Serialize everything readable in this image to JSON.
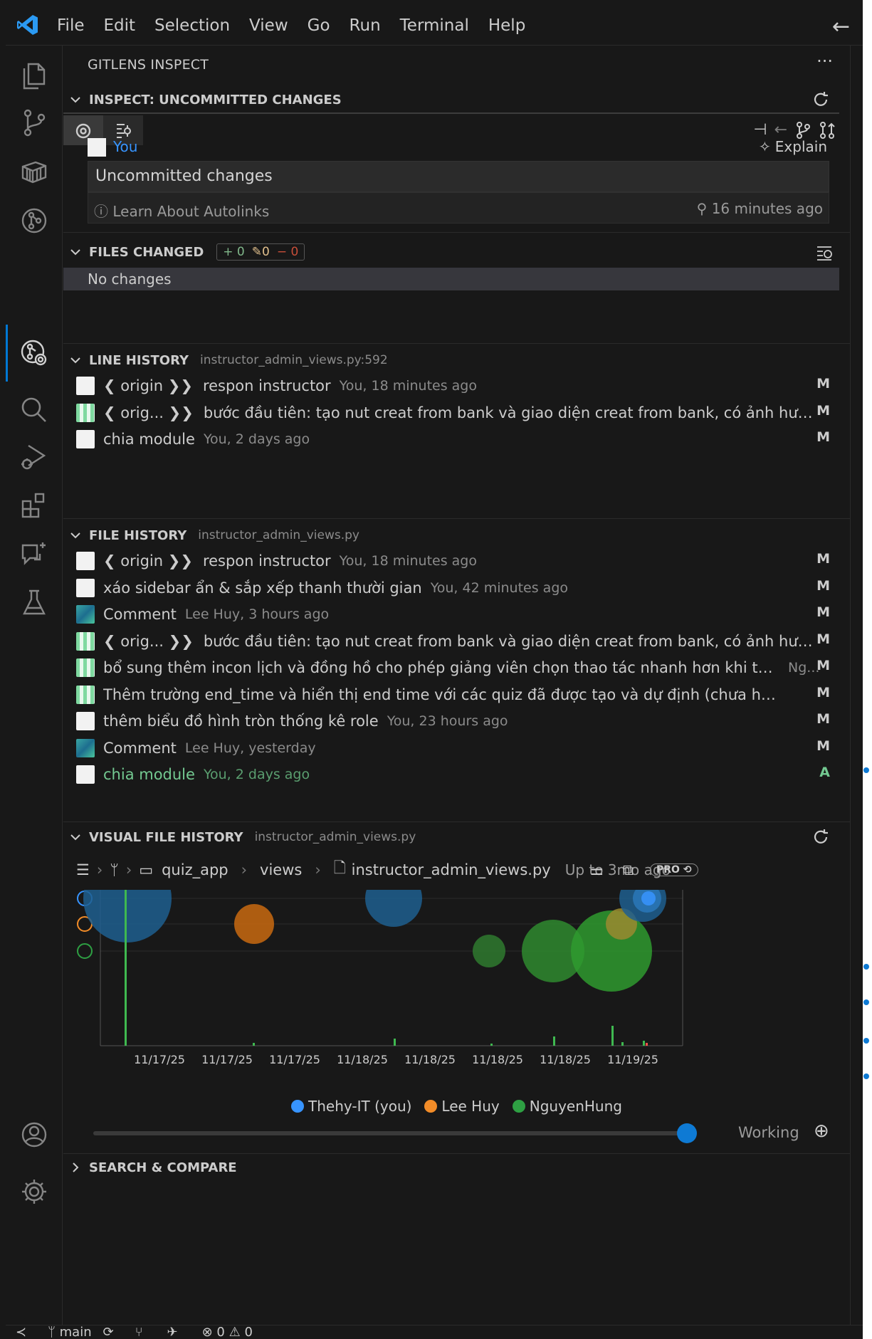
{
  "menu": [
    "File",
    "Edit",
    "Selection",
    "View",
    "Go",
    "Run",
    "Terminal",
    "Help"
  ],
  "sidebar": {
    "title": "GITLENS INSPECT"
  },
  "inspect": {
    "section_title": "INSPECT: UNCOMMITTED CHANGES",
    "author": "You",
    "explain_label": "Explain",
    "commit_title": "Uncommitted changes",
    "autolinks_label": "Learn About Autolinks",
    "time": "16 minutes ago"
  },
  "files_changed": {
    "title": "FILES CHANGED",
    "added": "+ 0",
    "modified": "0",
    "deleted": "− 0",
    "empty": "No changes"
  },
  "line_history": {
    "title": "LINE HISTORY",
    "file": "instructor_admin_views.py:592",
    "rows": [
      {
        "branch": "❮ origin ❯❯",
        "msg": "respon instructor",
        "meta": "You, 18 minutes ago",
        "status": "M",
        "avatar": "you"
      },
      {
        "branch": "❮ orig... ❯❯",
        "msg": "bước đầu tiên: tạo nut creat from bank và giao diện creat from bank, có ảnh hưởng đế...",
        "meta": "",
        "status": "M",
        "avatar": "ng"
      },
      {
        "branch": "",
        "msg": "chia module",
        "meta": "You, 2 days ago",
        "status": "M",
        "avatar": "you"
      }
    ]
  },
  "file_history": {
    "title": "FILE HISTORY",
    "file": "instructor_admin_views.py",
    "rows": [
      {
        "branch": "❮ origin ❯❯",
        "msg": "respon instructor",
        "meta": "You, 18 minutes ago",
        "status": "M",
        "avatar": "you"
      },
      {
        "branch": "",
        "msg": "xáo sidebar ẩn & sắp xếp thanh thười gian",
        "meta": "You, 42 minutes ago",
        "status": "M",
        "avatar": "you"
      },
      {
        "branch": "",
        "msg": "Comment",
        "meta": "Lee Huy, 3 hours ago",
        "status": "M",
        "avatar": "lee"
      },
      {
        "branch": "❮ orig... ❯❯",
        "msg": "bước đầu tiên: tạo nut creat from bank và giao diện creat from bank, có ảnh hưởng đế...",
        "meta": "",
        "status": "M",
        "avatar": "ng"
      },
      {
        "branch": "",
        "msg": "bổ sung thêm incon lịch và đồng hồ cho phép giảng viên chọn thao tác nhanh hơn khi tạo quiz",
        "meta": "Ng...",
        "status": "M",
        "avatar": "ng"
      },
      {
        "branch": "",
        "msg": "Thêm trường end_time và hiển thị end time với các quiz đã được tạo và dự định (chưa hiển thị lịch ...",
        "meta": "",
        "status": "M",
        "avatar": "ng"
      },
      {
        "branch": "",
        "msg": "thêm biểu đồ hình tròn thống kê role",
        "meta": "You, 23 hours ago",
        "status": "M",
        "avatar": "you"
      },
      {
        "branch": "",
        "msg": "Comment",
        "meta": "Lee Huy, yesterday",
        "status": "M",
        "avatar": "lee"
      },
      {
        "branch": "",
        "msg": "chia module",
        "meta": "You, 2 days ago",
        "status": "A",
        "avatar": "you",
        "added": true
      }
    ]
  },
  "visual_history": {
    "title": "VISUAL FILE HISTORY",
    "file": "instructor_admin_views.py",
    "crumbs": [
      "quiz_app",
      "views",
      "instructor_admin_views.py"
    ],
    "range": "Up to 3mo ago",
    "pro": "PRO",
    "working_label": "Working"
  },
  "chart_data": {
    "type": "scatter",
    "x_ticks": [
      "11/17/25",
      "11/17/25",
      "11/17/25",
      "11/18/25",
      "11/18/25",
      "11/18/25",
      "11/18/25",
      "11/19/25"
    ],
    "legend": [
      "Thehy-IT (you)",
      "Lee Huy",
      "NguyenHung"
    ],
    "colors": {
      "Thehy-IT (you)": "#1f5f8f",
      "Lee Huy": "#c96a10",
      "NguyenHung": "#2f8a2f"
    }
  },
  "search_compare": {
    "title": "SEARCH & COMPARE"
  },
  "statusbar": {
    "branch": "main",
    "errors": "0",
    "warnings": "0"
  }
}
